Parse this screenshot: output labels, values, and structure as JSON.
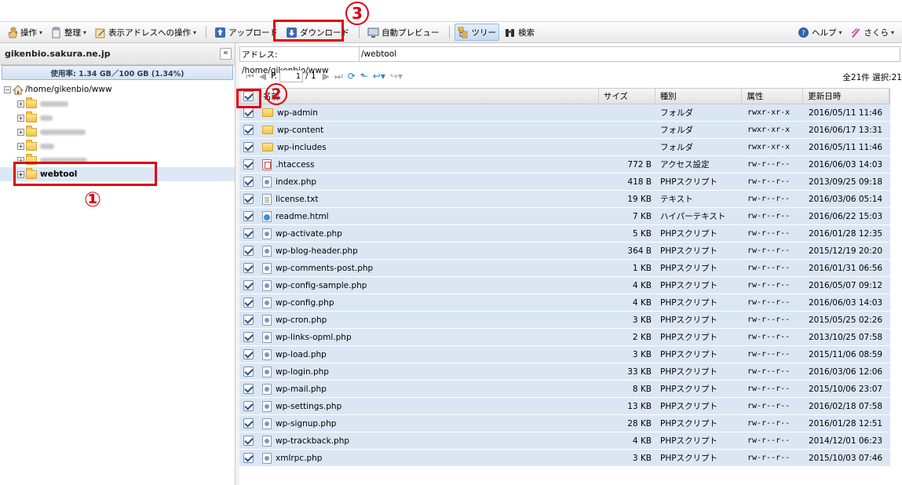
{
  "toolbar": {
    "items": [
      {
        "label": "操作",
        "icon": "hand-icon",
        "caret": true
      },
      {
        "label": "整理",
        "icon": "clipboard-icon",
        "caret": true
      },
      {
        "label": "表示アドレスへの操作",
        "icon": "pencil-icon",
        "caret": true
      },
      {
        "label": "アップロード",
        "icon": "upload-icon",
        "caret": false
      },
      {
        "label": "ダウンロード",
        "icon": "download-icon",
        "caret": false
      },
      {
        "label": "自動プレビュー",
        "icon": "monitor-icon",
        "caret": false
      },
      {
        "label": "ツリー",
        "icon": "tree-icon",
        "caret": false
      },
      {
        "label": "検索",
        "icon": "binoculars-icon",
        "caret": false
      }
    ],
    "help_label": "ヘルプ",
    "sakura_label": "さくら"
  },
  "sidebar": {
    "host": "gikenbio.sakura.ne.jp",
    "collapse_label": "«",
    "usage": "使用率: 1.34 GB／100 GB (1.34%)",
    "root": "/home/gikenbio/www",
    "selected_folder": "webtool"
  },
  "address": {
    "label": "アドレス: /home/gikenbio/www",
    "value": "/webtool"
  },
  "pager": {
    "page_prefix": "P.",
    "page": "1",
    "total": "/ 1",
    "info": "全21件 選択:21"
  },
  "columns": [
    "名前",
    "サイズ",
    "種別",
    "属性",
    "更新日時"
  ],
  "files": [
    {
      "name": "wp-admin",
      "size": "",
      "type": "フォルダ",
      "perm": "rwxr-xr-x",
      "date": "2016/05/11 11:46",
      "icon": "folder"
    },
    {
      "name": "wp-content",
      "size": "",
      "type": "フォルダ",
      "perm": "rwxr-xr-x",
      "date": "2016/06/17 13:31",
      "icon": "folder"
    },
    {
      "name": "wp-includes",
      "size": "",
      "type": "フォルダ",
      "perm": "rwxr-xr-x",
      "date": "2016/05/11 11:46",
      "icon": "folder"
    },
    {
      "name": ".htaccess",
      "size": "772 B",
      "type": "アクセス設定",
      "perm": "rw-r--r--",
      "date": "2016/06/03 14:03",
      "icon": "pdf"
    },
    {
      "name": "index.php",
      "size": "418 B",
      "type": "PHPスクリプト",
      "perm": "rw-r--r--",
      "date": "2013/09/25 09:18",
      "icon": "php"
    },
    {
      "name": "license.txt",
      "size": "19 KB",
      "type": "テキスト",
      "perm": "rw-r--r--",
      "date": "2016/03/06 05:14",
      "icon": "txt"
    },
    {
      "name": "readme.html",
      "size": "7 KB",
      "type": "ハイパーテキスト",
      "perm": "rw-r--r--",
      "date": "2016/06/22 15:03",
      "icon": "html"
    },
    {
      "name": "wp-activate.php",
      "size": "5 KB",
      "type": "PHPスクリプト",
      "perm": "rw-r--r--",
      "date": "2016/01/28 12:35",
      "icon": "php"
    },
    {
      "name": "wp-blog-header.php",
      "size": "364 B",
      "type": "PHPスクリプト",
      "perm": "rw-r--r--",
      "date": "2015/12/19 20:20",
      "icon": "php"
    },
    {
      "name": "wp-comments-post.php",
      "size": "1 KB",
      "type": "PHPスクリプト",
      "perm": "rw-r--r--",
      "date": "2016/01/31 06:56",
      "icon": "php"
    },
    {
      "name": "wp-config-sample.php",
      "size": "4 KB",
      "type": "PHPスクリプト",
      "perm": "rw-r--r--",
      "date": "2016/05/07 09:12",
      "icon": "php"
    },
    {
      "name": "wp-config.php",
      "size": "4 KB",
      "type": "PHPスクリプト",
      "perm": "rw-r--r--",
      "date": "2016/06/03 14:03",
      "icon": "php"
    },
    {
      "name": "wp-cron.php",
      "size": "3 KB",
      "type": "PHPスクリプト",
      "perm": "rw-r--r--",
      "date": "2015/05/25 02:26",
      "icon": "php"
    },
    {
      "name": "wp-links-opml.php",
      "size": "2 KB",
      "type": "PHPスクリプト",
      "perm": "rw-r--r--",
      "date": "2013/10/25 07:58",
      "icon": "php"
    },
    {
      "name": "wp-load.php",
      "size": "3 KB",
      "type": "PHPスクリプト",
      "perm": "rw-r--r--",
      "date": "2015/11/06 08:59",
      "icon": "php"
    },
    {
      "name": "wp-login.php",
      "size": "33 KB",
      "type": "PHPスクリプト",
      "perm": "rw-r--r--",
      "date": "2016/03/06 12:06",
      "icon": "php"
    },
    {
      "name": "wp-mail.php",
      "size": "8 KB",
      "type": "PHPスクリプト",
      "perm": "rw-r--r--",
      "date": "2015/10/06 23:07",
      "icon": "php"
    },
    {
      "name": "wp-settings.php",
      "size": "13 KB",
      "type": "PHPスクリプト",
      "perm": "rw-r--r--",
      "date": "2016/02/18 07:58",
      "icon": "php"
    },
    {
      "name": "wp-signup.php",
      "size": "28 KB",
      "type": "PHPスクリプト",
      "perm": "rw-r--r--",
      "date": "2016/01/28 12:51",
      "icon": "php"
    },
    {
      "name": "wp-trackback.php",
      "size": "4 KB",
      "type": "PHPスクリプト",
      "perm": "rw-r--r--",
      "date": "2014/12/01 06:23",
      "icon": "php"
    },
    {
      "name": "xmlrpc.php",
      "size": "3 KB",
      "type": "PHPスクリプト",
      "perm": "rw-r--r--",
      "date": "2015/10/03 07:46",
      "icon": "php"
    }
  ],
  "annotations": {
    "one": "①",
    "two": "2",
    "three": "3"
  },
  "colors": {
    "row_bg": "#dbe6f4",
    "annotation_red": "#e0000e",
    "usage_bg": "#d3e1f2"
  }
}
